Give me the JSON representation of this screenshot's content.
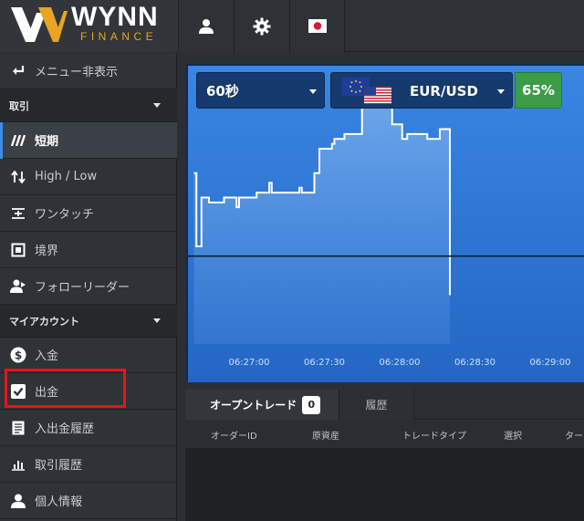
{
  "brand": {
    "name": "WYNN",
    "subtitle": "FINANCE"
  },
  "topbar": {
    "buttons": [
      {
        "icon": "user-icon"
      },
      {
        "icon": "gear-icon"
      },
      {
        "icon": "japan-flag-icon"
      }
    ]
  },
  "sidebar": {
    "hide_menu": "メニュー非表示",
    "section_trade": "取引",
    "items_trade": [
      {
        "icon": "slash-icon",
        "label": "短期"
      },
      {
        "icon": "arrows-updown-icon",
        "label": "High / Low"
      },
      {
        "icon": "touch-icon",
        "label": "ワンタッチ"
      },
      {
        "icon": "boundary-icon",
        "label": "境界"
      },
      {
        "icon": "follow-leader-icon",
        "label": "フォローリーダー"
      }
    ],
    "section_account": "マイアカウント",
    "items_account": [
      {
        "icon": "dollar-icon",
        "label": "入金"
      },
      {
        "icon": "check-icon",
        "label": "出金"
      },
      {
        "icon": "history-doc-icon",
        "label": "入出金履歴"
      },
      {
        "icon": "bar-chart-icon",
        "label": "取引履歴"
      },
      {
        "icon": "person-icon",
        "label": "個人情報"
      }
    ]
  },
  "controls": {
    "duration": "60秒",
    "asset": "EUR/USD",
    "payout": "65%"
  },
  "colors": {
    "chart_bg": "#2f78d6",
    "chart_line": "#ffffff",
    "payout_green": "#3c9c48",
    "highlight_red": "#e5141c"
  },
  "chart_data": {
    "type": "area",
    "x_ticks": [
      "06:27:00",
      "06:27:30",
      "06:28:00",
      "06:28:30",
      "06:29:00"
    ],
    "x_seconds": [
      0,
      30,
      60,
      90,
      120,
      140
    ],
    "points": [
      [
        -22,
        1.0
      ],
      [
        -21,
        0.9985
      ],
      [
        -19,
        0.9995
      ],
      [
        -16,
        0.9994
      ],
      [
        -10,
        0.9995
      ],
      [
        -6,
        0.9995
      ],
      [
        -5,
        0.9993
      ],
      [
        -4,
        0.9995
      ],
      [
        0,
        0.9995
      ],
      [
        3,
        0.9996
      ],
      [
        7,
        0.9996
      ],
      [
        8,
        0.9998
      ],
      [
        9,
        0.9996
      ],
      [
        20,
        0.9997
      ],
      [
        21,
        0.9996
      ],
      [
        25,
        0.9996
      ],
      [
        26,
        1.0
      ],
      [
        27,
        1.0
      ],
      [
        28,
        1.0005
      ],
      [
        29,
        1.0005
      ],
      [
        33,
        1.0006
      ],
      [
        34,
        1.0007
      ],
      [
        37,
        1.0007
      ],
      [
        38,
        1.0008
      ],
      [
        44,
        1.0008
      ],
      [
        45,
        1.0017
      ],
      [
        47,
        1.0017
      ],
      [
        48,
        1.0015
      ],
      [
        50,
        1.0015
      ],
      [
        51,
        1.0016
      ],
      [
        52,
        1.0016
      ],
      [
        53,
        1.0017
      ],
      [
        56,
        1.0017
      ],
      [
        57,
        1.001
      ],
      [
        58,
        1.001
      ],
      [
        60,
        1.001
      ],
      [
        61,
        1.0007
      ],
      [
        62,
        1.0007
      ],
      [
        63,
        1.0008
      ],
      [
        70,
        1.0008
      ],
      [
        71,
        1.0007
      ],
      [
        74,
        1.0007
      ],
      [
        76,
        1.0009
      ],
      [
        78,
        1.0009
      ],
      [
        80,
        0.9975
      ]
    ],
    "ylim": [
      0.9965,
      1.0022
    ],
    "baseline": 0.9983,
    "grid": false
  },
  "tabs": {
    "open_trades": "オープントレード",
    "open_count": "0",
    "history": "履歴"
  },
  "table": {
    "columns": [
      "オーダーID",
      "原資産",
      "トレードタイプ",
      "選択",
      "ター"
    ]
  }
}
